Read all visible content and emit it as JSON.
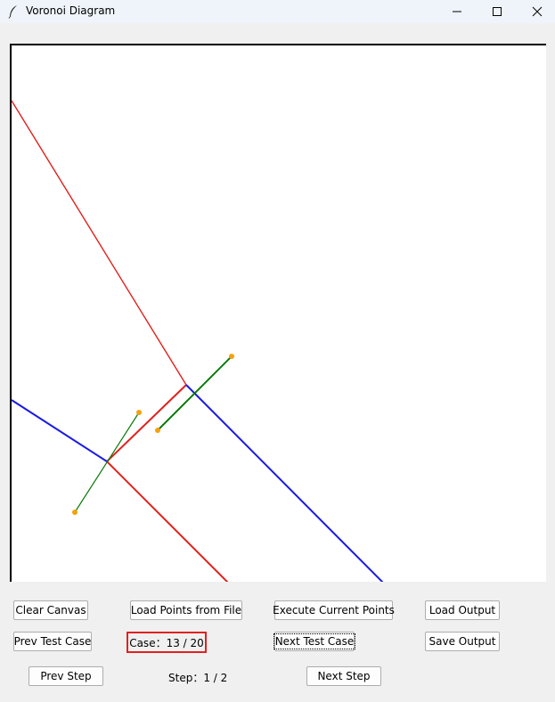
{
  "window": {
    "title": "Voronoi Diagram"
  },
  "icons": {
    "app": "feather-icon",
    "minimize": "minimize-icon",
    "maximize": "maximize-icon",
    "close": "close-icon"
  },
  "buttons": {
    "clear_canvas": "Clear Canvas",
    "load_points": "Load Points from File",
    "execute_points": "Execute Current Points",
    "load_output": "Load Output",
    "prev_test_case": "Prev Test Case",
    "next_test_case": "Next Test Case",
    "save_output": "Save Output",
    "prev_step": "Prev Step",
    "next_step": "Next Step"
  },
  "status": {
    "case": "Case：13 / 20",
    "step": "Step：1 / 2"
  },
  "colors": {
    "red_edge": "#e0201c",
    "blue_edge": "#1a1ae6",
    "green_line": "#0a7a0a",
    "point": "#f5a10a",
    "case_box_border": "#e0211f"
  }
}
